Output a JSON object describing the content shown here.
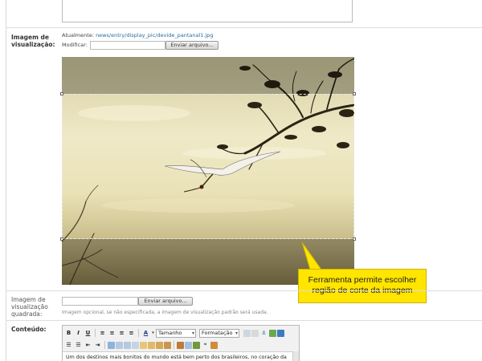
{
  "preview_image": {
    "label_line1": "Imagem de",
    "label_line2": "visualização:",
    "current_prefix": "Atualmente:",
    "current_path": "news/entry/display_pic/devide_pantanal1.jpg",
    "modify_label": "Modificar:",
    "upload_button": "Enviar arquivo..."
  },
  "square_preview": {
    "label_line1": "Imagem de",
    "label_line2": "visualização",
    "label_line3": "quadrada:",
    "upload_button": "Enviar arquivo...",
    "hint": "Imagem opcional, se não especificada, a imagem de visualização padrão será usada."
  },
  "callout": {
    "line1": "Ferramenta permite escolher",
    "line2": "região de corte da imagem",
    "color": "#ffe500"
  },
  "content": {
    "label": "Conteúdo:",
    "toolbar_row1": {
      "bold": "B",
      "italic": "I",
      "underline": "U",
      "font_color": "A",
      "size_select": "Tamanho",
      "format_select": "Formatação"
    },
    "body_text": "Um dos destinos mais bonitos do mundo está bem perto dos brasileiros, no coração da"
  }
}
